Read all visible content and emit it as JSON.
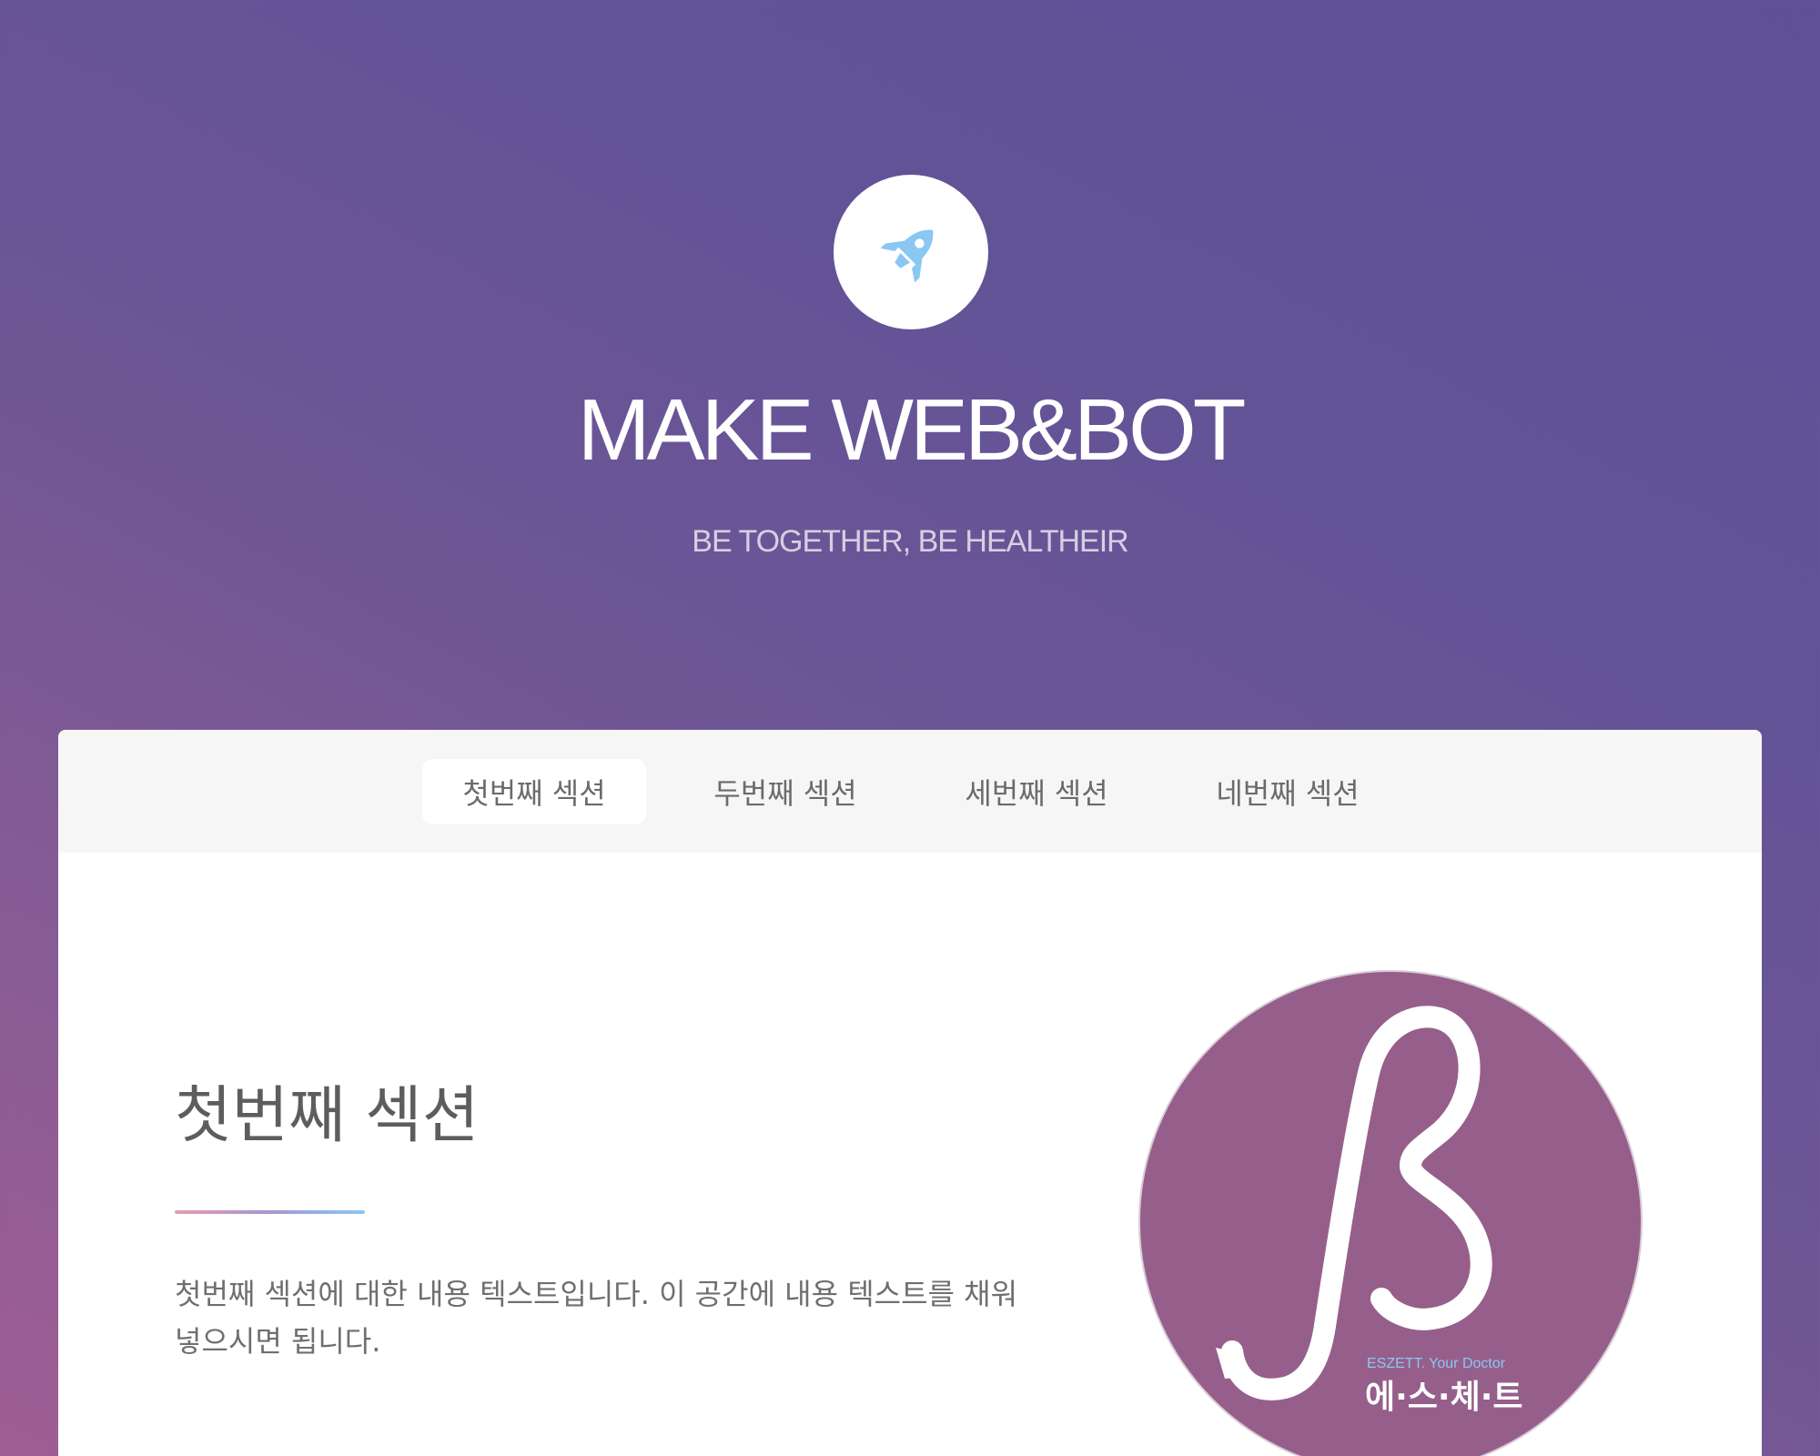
{
  "hero": {
    "icon": "rocket-icon",
    "title": "MAKE WEB&BOT",
    "subtitle": "BE TOGETHER, BE HEALTHEIR"
  },
  "tabs": [
    {
      "label": "첫번째 섹션",
      "active": true
    },
    {
      "label": "두번째 섹션",
      "active": false
    },
    {
      "label": "세번째 섹션",
      "active": false
    },
    {
      "label": "네번째 섹션",
      "active": false
    }
  ],
  "section": {
    "title": "첫번째 섹션",
    "body": "첫번째 섹션에 대한 내용 텍스트입니다. 이 공간에 내용 텍스트를 채워 넣으시면 됩니다."
  },
  "logo": {
    "tagline": "ESZETT. Your Doctor",
    "brand": "에·스·체·트"
  },
  "colors": {
    "accent_blue": "#8ac7f2",
    "logo_purple": "#965f8b",
    "divider_pink": "#e89ab6"
  }
}
